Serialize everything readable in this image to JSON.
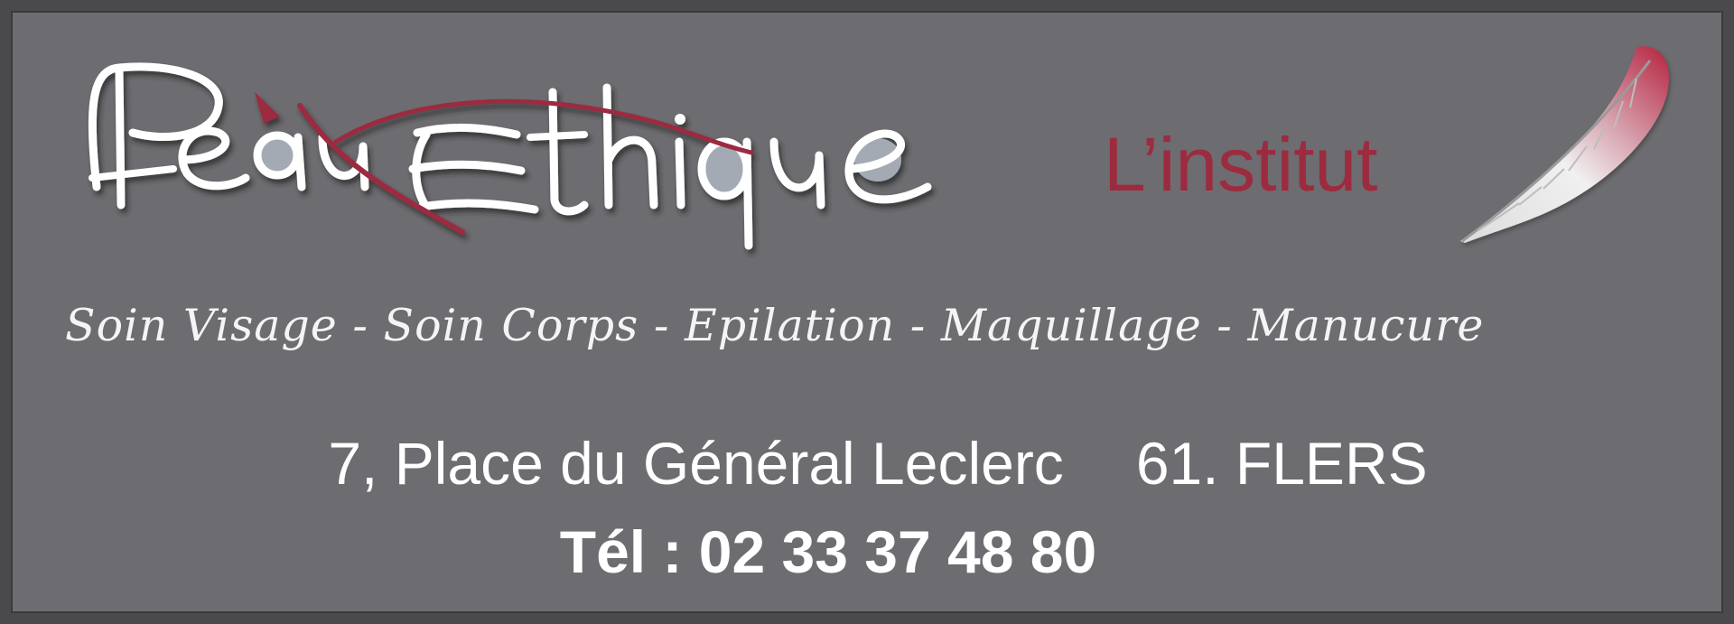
{
  "logo": {
    "brand_name": "PeauEthique",
    "tagline": "L’institut"
  },
  "services_text": "Soin Visage - Soin Corps - Epilation - Maquillage - Manucure",
  "address": {
    "street": "7, Place du Général Leclerc",
    "city": "61. FLERS"
  },
  "phone": {
    "label": "Tél : ",
    "number": "02 33 37 48 80"
  },
  "colors": {
    "background": "#6d6c70",
    "border": "#4a4a4d",
    "accent": "#9c2b3f",
    "text": "#ffffff"
  },
  "icons": [
    "feather-icon"
  ]
}
